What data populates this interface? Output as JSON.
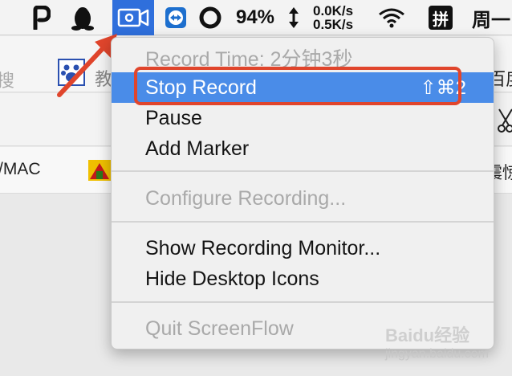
{
  "menubar": {
    "battery": "94%",
    "net_up": "0.0K/s",
    "net_down": "0.5K/s",
    "ime": "拼",
    "day": "周一"
  },
  "background": {
    "row1_left": "搜",
    "row1_tab": "教",
    "row1_right": "器_百度",
    "row3_left": "/MAC",
    "row3_right": "你震惊"
  },
  "menu": {
    "record_time": "Record Time: 2分钟3秒",
    "stop_record": "Stop Record",
    "stop_shortcut": "⇧⌘2",
    "pause": "Pause",
    "add_marker": "Add Marker",
    "configure": "Configure Recording...",
    "show_monitor": "Show Recording Monitor...",
    "hide_icons": "Hide Desktop Icons",
    "quit": "Quit ScreenFlow"
  },
  "watermark": {
    "brand": "Baidu经验",
    "url": "jingyan.baidu.com"
  },
  "colors": {
    "selected": "#4a8ce8",
    "recording_icon_bg": "#2f6fdc",
    "annotation": "#e0452c"
  }
}
